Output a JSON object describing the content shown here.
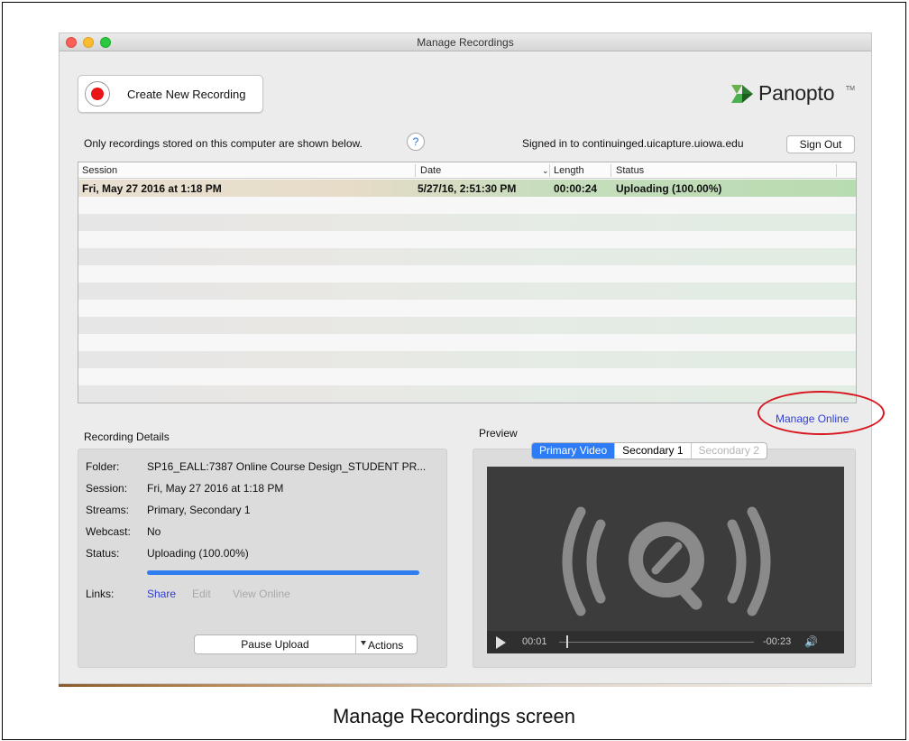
{
  "window": {
    "title": "Manage Recordings"
  },
  "toolbar": {
    "create_label": "Create New Recording"
  },
  "brand": {
    "name": "Panopto",
    "tm": "TM"
  },
  "info": {
    "stored_note": "Only recordings stored on this computer are shown below.",
    "help": "?",
    "signed_in": "Signed in to continuinged.uicapture.uiowa.edu",
    "sign_out": "Sign Out"
  },
  "table": {
    "columns": [
      "Session",
      "Date",
      "Length",
      "Status"
    ],
    "rows": [
      {
        "session": "Fri, May 27 2016 at 1:18 PM",
        "date": "5/27/16, 2:51:30 PM",
        "length": "00:00:24",
        "status": "Uploading (100.00%)"
      }
    ]
  },
  "manage_online": "Manage Online",
  "details": {
    "title": "Recording Details",
    "folder_label": "Folder:",
    "folder": "SP16_EALL:7387 Online Course Design_STUDENT PR...",
    "session_label": "Session:",
    "session": "Fri, May 27 2016 at 1:18 PM",
    "streams_label": "Streams:",
    "streams": "Primary, Secondary 1",
    "webcast_label": "Webcast:",
    "webcast": "No",
    "status_label": "Status:",
    "status": "Uploading (100.00%)",
    "progress": 1.0,
    "links_label": "Links:",
    "links": {
      "share": "Share",
      "edit": "Edit",
      "view_online": "View Online"
    },
    "pause_upload": "Pause Upload",
    "actions": "Actions"
  },
  "preview": {
    "title": "Preview",
    "tabs": [
      "Primary Video",
      "Secondary 1",
      "Secondary 2"
    ],
    "time_elapsed": "00:01",
    "time_remaining": "-00:23"
  },
  "caption": "Manage Recordings screen",
  "colors": {
    "accent": "#2d7cf6",
    "link": "#2f3fd6",
    "record": "#ea1515",
    "annotation": "#d8161e"
  }
}
